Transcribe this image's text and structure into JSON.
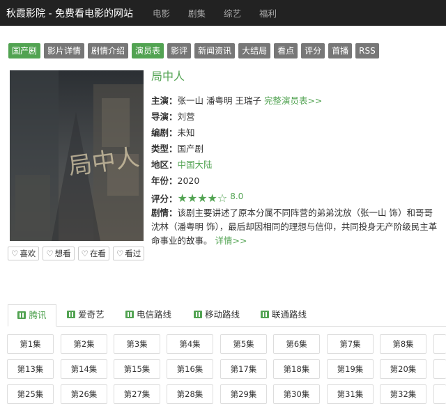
{
  "site": {
    "title": "秋霞影院 - 免费看电影的网站",
    "nav": [
      "电影",
      "剧集",
      "综艺",
      "福利"
    ]
  },
  "tags": [
    {
      "label": "国产剧",
      "active": true
    },
    {
      "label": "影片详情",
      "active": false
    },
    {
      "label": "剧情介绍",
      "active": false
    },
    {
      "label": "演员表",
      "active": true
    },
    {
      "label": "影评",
      "active": false
    },
    {
      "label": "新闻资讯",
      "active": false
    },
    {
      "label": "大结局",
      "active": false
    },
    {
      "label": "看点",
      "active": false
    },
    {
      "label": "评分",
      "active": false
    },
    {
      "label": "首播",
      "active": false
    },
    {
      "label": "RSS",
      "active": false
    }
  ],
  "poster": {
    "text": "局中人"
  },
  "likes": [
    "喜欢",
    "想看",
    "在看",
    "看过"
  ],
  "detail": {
    "title": "局中人",
    "actors_label": "主演：",
    "actors": "张一山 潘粤明 王瑞子",
    "full_cast_link": "完整演员表>>",
    "director_label": "导演：",
    "director": "刘营",
    "writer_label": "编剧：",
    "writer": "未知",
    "type_label": "类型：",
    "type": "国产剧",
    "region_label": "地区：",
    "region": "中国大陆",
    "year_label": "年份：",
    "year": "2020",
    "rating_label": "评分：",
    "rating": "8.0",
    "rating_stars_filled": 4,
    "rating_stars_total": 5,
    "plot_label": "剧情：",
    "plot": "该剧主要讲述了原本分属不同阵营的弟弟沈放（张一山 饰）和哥哥沈林（潘粤明 饰），最后却因相同的理想与信仰，共同投身无产阶级民主革命事业的故事。",
    "more_link": "详情>>"
  },
  "sources": [
    {
      "label": "腾讯",
      "active": true
    },
    {
      "label": "爱奇艺",
      "active": false
    },
    {
      "label": "电信路线",
      "active": false
    },
    {
      "label": "移动路线",
      "active": false
    },
    {
      "label": "联通路线",
      "active": false
    }
  ],
  "episodes": [
    "第1集",
    "第2集",
    "第3集",
    "第4集",
    "第5集",
    "第6集",
    "第7集",
    "第8集",
    "第13集",
    "第14集",
    "第15集",
    "第16集",
    "第17集",
    "第18集",
    "第19集",
    "第20集",
    "第25集",
    "第26集",
    "第27集",
    "第28集",
    "第29集",
    "第30集",
    "第31集",
    "第32集"
  ],
  "colors": {
    "accent": "#52a352",
    "topbar": "#222222",
    "tag": "#777777"
  }
}
